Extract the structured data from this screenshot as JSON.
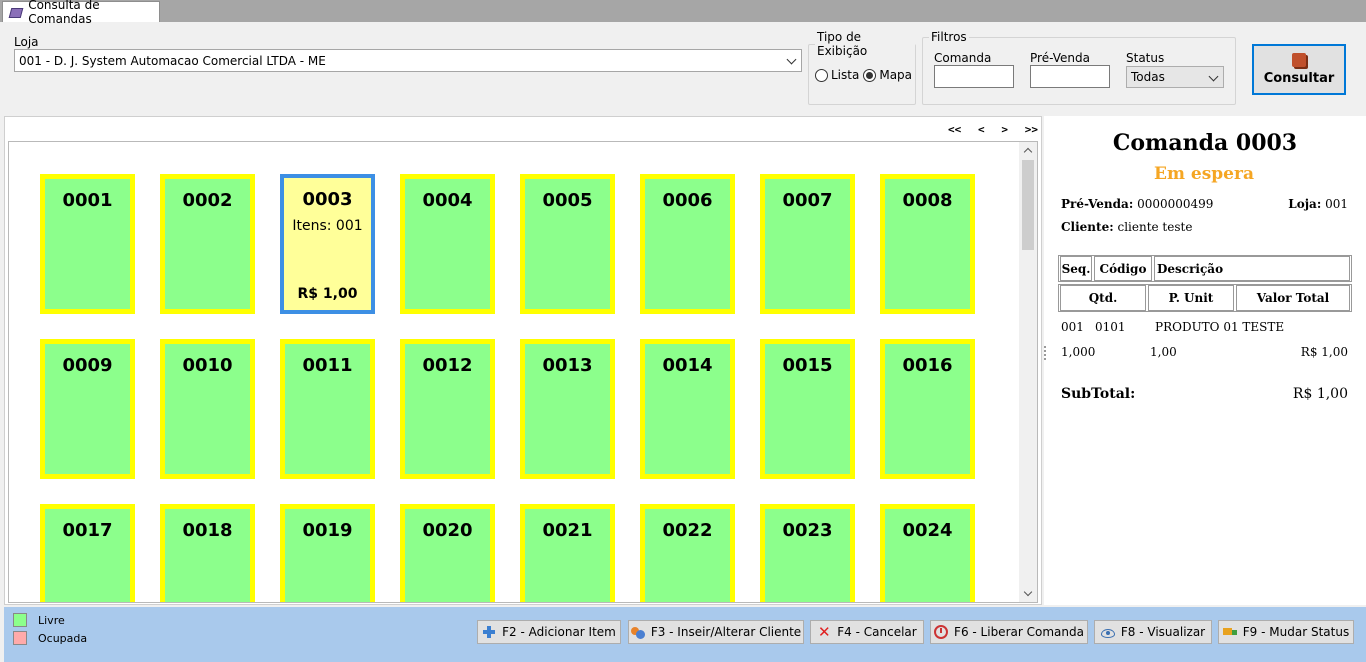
{
  "tab": {
    "title": "Consulta de Comandas"
  },
  "filters": {
    "loja_label": "Loja",
    "loja_value": "001 - D. J. System Automacao Comercial LTDA - ME",
    "tipo_label": "Tipo de Exibição",
    "lista_label": "Lista",
    "mapa_label": "Mapa",
    "selected_view": "Mapa",
    "filtros_label": "Filtros",
    "comanda_label": "Comanda",
    "comanda_value": "",
    "prevenda_label": "Pré-Venda",
    "prevenda_value": "",
    "status_label": "Status",
    "status_value": "Todas",
    "consultar_label": "Consultar"
  },
  "pager": {
    "first": "<<",
    "prev": "<",
    "next": ">",
    "last": ">>"
  },
  "comandas": [
    {
      "num": "0001",
      "status": "livre"
    },
    {
      "num": "0002",
      "status": "livre"
    },
    {
      "num": "0003",
      "status": "em-espera",
      "itens": "Itens: 001",
      "valor": "R$ 1,00",
      "selected": true
    },
    {
      "num": "0004",
      "status": "livre"
    },
    {
      "num": "0005",
      "status": "livre"
    },
    {
      "num": "0006",
      "status": "livre"
    },
    {
      "num": "0007",
      "status": "livre"
    },
    {
      "num": "0008",
      "status": "livre"
    },
    {
      "num": "0009",
      "status": "livre"
    },
    {
      "num": "0010",
      "status": "livre"
    },
    {
      "num": "0011",
      "status": "livre"
    },
    {
      "num": "0012",
      "status": "livre"
    },
    {
      "num": "0013",
      "status": "livre"
    },
    {
      "num": "0014",
      "status": "livre"
    },
    {
      "num": "0015",
      "status": "livre"
    },
    {
      "num": "0016",
      "status": "livre"
    },
    {
      "num": "0017",
      "status": "livre"
    },
    {
      "num": "0018",
      "status": "livre"
    },
    {
      "num": "0019",
      "status": "livre"
    },
    {
      "num": "0020",
      "status": "livre"
    },
    {
      "num": "0021",
      "status": "livre"
    },
    {
      "num": "0022",
      "status": "livre"
    },
    {
      "num": "0023",
      "status": "livre"
    },
    {
      "num": "0024",
      "status": "livre"
    }
  ],
  "detail": {
    "title": "Comanda 0003",
    "status": "Em espera",
    "prevenda_label": "Pré-Venda:",
    "prevenda_value": "0000000499",
    "loja_label": "Loja:",
    "loja_value": "001",
    "cliente_label": "Cliente:",
    "cliente_value": "cliente teste",
    "col_seq": "Seq.",
    "col_codigo": "Código",
    "col_descricao": "Descrição",
    "col_qtd": "Qtd.",
    "col_punit": "P. Unit",
    "col_valortotal": "Valor Total",
    "item": {
      "seq": "001",
      "codigo": "0101",
      "descricao": "PRODUTO 01 TESTE",
      "qtd": "1,000",
      "punit": "1,00",
      "total": "R$ 1,00"
    },
    "subtotal_label": "SubTotal:",
    "subtotal_value": "R$ 1,00"
  },
  "legend": {
    "livre_label": "Livre",
    "livre_color": "#8cff8c",
    "ocupada_label": "Ocupada",
    "ocupada_color": "#ffaaaa"
  },
  "actions": {
    "f2": "F2 - Adicionar Item",
    "f3": "F3 - Inseir/Alterar Cliente",
    "f4": "F4 - Cancelar",
    "f6": "F6 - Liberar Comanda",
    "f8": "F8 - Visualizar",
    "f9": "F9 - Mudar Status"
  },
  "colors": {
    "card_free": "#8cff8c",
    "card_border": "#ffff00",
    "card_selected": "#ffff99",
    "selection_border": "#3d8fe4",
    "status_em_espera": "#f5a623"
  }
}
